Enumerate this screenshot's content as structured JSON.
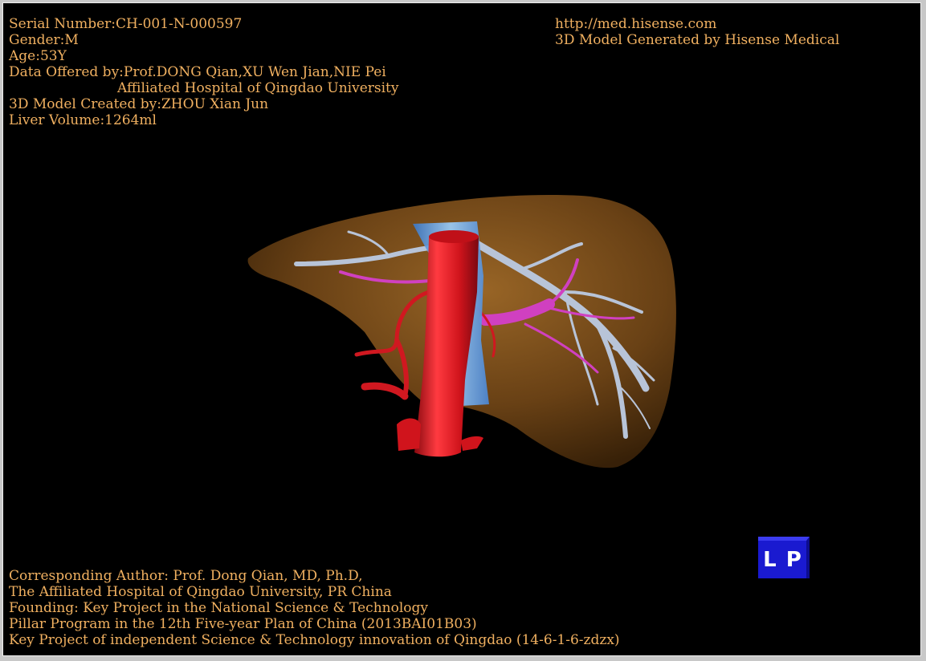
{
  "header_left": {
    "serial": "Serial Number:CH-001-N-000597",
    "gender": "Gender:M",
    "age": "Age:53Y",
    "data_offered": "Data Offered by:Prof.DONG Qian,XU Wen Jian,NIE Pei",
    "hospital": "Affiliated Hospital of Qingdao University",
    "model_created": "3D Model Created by:ZHOU Xian Jun",
    "liver_volume": "Liver Volume:1264ml"
  },
  "header_right": {
    "url": "http://med.hisense.com",
    "generated_by": "3D Model Generated by Hisense Medical"
  },
  "footer": {
    "line1": "Corresponding Author: Prof. Dong Qian, MD, Ph.D,",
    "line2": "The Affiliated Hospital of Qingdao University, PR China",
    "line3": "Founding: Key Project in the National Science & Technology",
    "line4": "Pillar Program in the 12th Five-year Plan of China (2013BAI01B03)",
    "line5": "Key Project of independent Science & Technology innovation of Qingdao (14-6-1-6-zdzx)"
  },
  "orientation_cube": {
    "left_label": "L",
    "right_label": "P",
    "color": "#1a1ad0"
  },
  "colors": {
    "text": "#f0b060",
    "liver": "#8a5a1e",
    "aorta": "#e0202a",
    "vena_cava": "#6aaaf0",
    "portal_vein": "#b8c4d8",
    "hepatic_artery": "#d040c0"
  }
}
